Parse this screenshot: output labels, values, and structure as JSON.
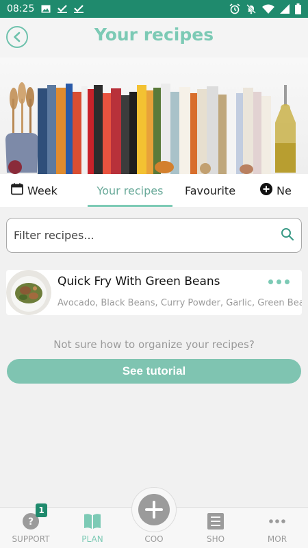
{
  "status_bar": {
    "time": "08:25"
  },
  "header": {
    "title": "Your recipes"
  },
  "tabs": [
    {
      "label": "Week",
      "icon": "calendar-icon"
    },
    {
      "label": "Your recipes"
    },
    {
      "label": "Favourite"
    },
    {
      "label": "Ne",
      "icon": "plus-circle-icon"
    }
  ],
  "search": {
    "placeholder": "Filter recipes..."
  },
  "recipes": [
    {
      "name": "Quick Fry With Green Beans",
      "ingredients": "Avocado, Black Beans, Curry Powder, Garlic, Green Beans, H"
    }
  ],
  "tutorial": {
    "hint": "Not sure how to organize your recipes?",
    "button_label": "See tutorial"
  },
  "bottom_nav": {
    "support": {
      "label": "SUPPORT",
      "badge": "1",
      "icon": "help-icon"
    },
    "plan": {
      "label": "PLAN",
      "icon": "book-icon"
    },
    "cook": {
      "label": "COO",
      "icon": "plus-icon"
    },
    "shop": {
      "label": "SHO",
      "icon": "list-icon"
    },
    "more": {
      "label": "MOR",
      "icon": "more-dots-icon"
    }
  },
  "colors": {
    "status_bar": "#1f8a6d",
    "accent": "#7ccab5",
    "button": "#7fc4b1"
  }
}
